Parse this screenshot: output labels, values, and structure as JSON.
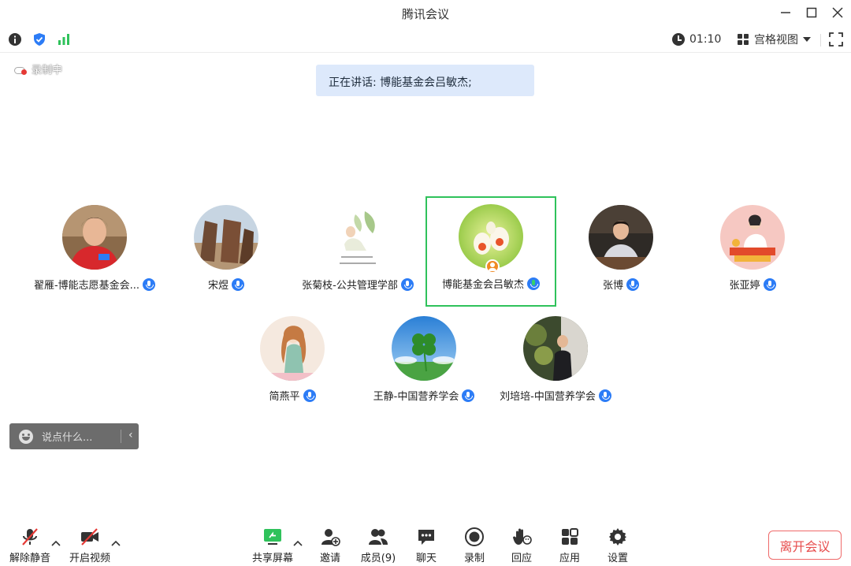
{
  "window": {
    "title": "腾讯会议"
  },
  "infobar": {
    "timer": "01:10",
    "view_mode": "宫格视图"
  },
  "recording": {
    "label": "录制中"
  },
  "speaking": {
    "text": "正在讲话: 博能基金会吕敏杰;"
  },
  "participants": [
    {
      "name": "翟雁-博能志愿基金会...",
      "active": false
    },
    {
      "name": "宋煜",
      "active": false
    },
    {
      "name": "张菊枝-公共管理学部",
      "active": false
    },
    {
      "name": "博能基金会吕敏杰",
      "active": true
    },
    {
      "name": "张博",
      "active": false
    },
    {
      "name": "张亚婷",
      "active": false
    },
    {
      "name": "简燕平",
      "active": false
    },
    {
      "name": "王静-中国营养学会",
      "active": false
    },
    {
      "name": "刘培培-中国营养学会",
      "active": false
    }
  ],
  "chat": {
    "placeholder": "说点什么..."
  },
  "toolbar": {
    "unmute": "解除静音",
    "video": "开启视频",
    "share": "共享屏幕",
    "invite": "邀请",
    "members": "成员(9)",
    "chat": "聊天",
    "record": "录制",
    "reaction": "回应",
    "apps": "应用",
    "settings": "设置",
    "leave": "离开会议"
  },
  "colors": {
    "accent": "#2c7cf6",
    "active_border": "#2fc25b",
    "leave": "#e74c4c",
    "speaking_bg": "#dde9fb"
  }
}
